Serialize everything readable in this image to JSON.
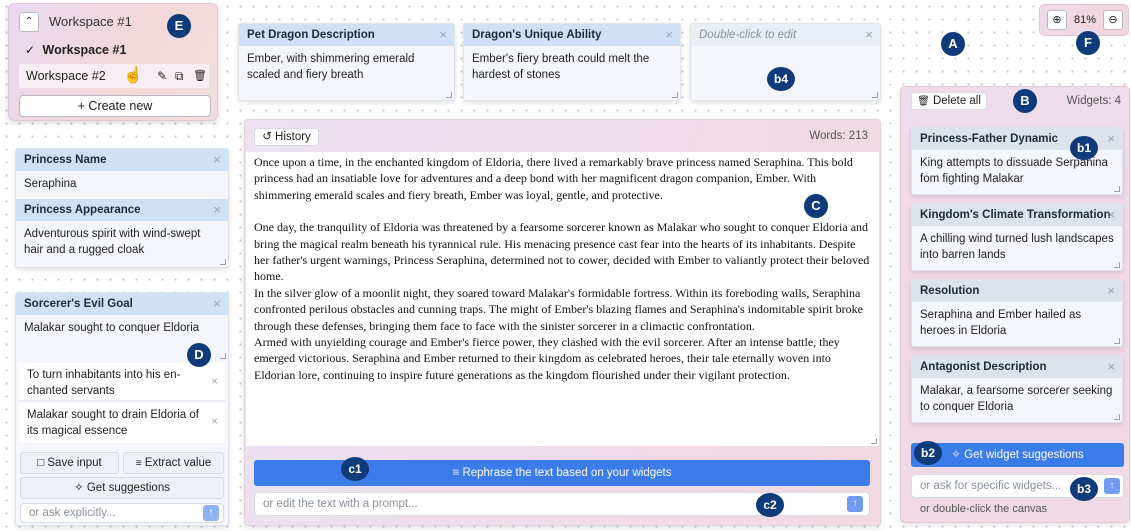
{
  "workspace_menu": {
    "current": "Workspace #1",
    "items": [
      {
        "label": "Workspace #1",
        "checked": true
      },
      {
        "label": "Workspace #2",
        "checked": false
      }
    ],
    "create_label": "+ Create new"
  },
  "canvas_zoom": {
    "value": "81%"
  },
  "top_widgets": [
    {
      "title": "Pet Dragon Description",
      "body": "Ember, with shimmering emerald scaled and fiery breath"
    },
    {
      "title": "Dragon's Unique Ability",
      "body": "Ember's fiery breath could melt the hardest of stones"
    },
    {
      "title": "Double-click to edit",
      "body": ""
    }
  ],
  "left_widgets": [
    {
      "title": "Princess Name",
      "body": "Seraphina"
    },
    {
      "title": "Princess Appearance",
      "body": "Adventurous spirit with wind-swept hair and a rugged cloak"
    }
  ],
  "goal_widget": {
    "title": "Sorcerer's Evil Goal",
    "body": "Malakar sought to conquer Eldoria",
    "suggestions": [
      "To turn inhabitants into his en-chanted servants",
      "Malakar sought to drain Eldoria of its magical essence"
    ],
    "save_label": "Save input",
    "extract_label": "Extract value",
    "suggest_label": "Get suggestions",
    "ask_placeholder": "or ask explicitly..."
  },
  "editor": {
    "history_label": "History",
    "word_count": "Words: 213",
    "paragraphs": [
      "Once upon a time, in the enchanted kingdom of Eldoria, there lived a remarkably brave princess named Seraphina. This bold princess had an insatiable love for adventures and a deep bond with her magnificent dragon companion, Ember. With shimmering emerald scales and fiery breath, Ember was loyal, gentle, and protective.",
      "",
      "One day, the tranquility of Eldoria was threatened by a fearsome sorcerer known as Malakar who sought to conquer Eldoria and bring the magical realm beneath his tyrannical rule. His menacing presence cast fear into the hearts of its inhabitants. Despite her father's urgent warnings, Princess Seraphina, determined not to cower, decided with Ember to valiantly protect their beloved home.",
      "In the silver glow of a moonlit night, they soared toward Malakar's formidable fortress. Within its foreboding walls, Seraphina confronted perilous obstacles and cunning traps. The might of Ember's blazing flames and Seraphina's indomitable spirit broke through these defenses, bringing them face to face with the sinister sorcerer in a climactic confrontation.",
      "Armed with unyielding courage and Ember's fierce power, they clashed with the evil sorcerer. After an intense battle, they emerged victorious. Seraphina and Ember returned to their kingdom as celebrated heroes, their tale eternally woven into Eldorian lore, continuing to inspire future generations as the kingdom flourished under their vigilant protection."
    ],
    "rephrase_label": "Rephrase the text based on your widgets",
    "prompt_placeholder": "or edit the text with a prompt..."
  },
  "right_panel": {
    "delete_label": "Delete all",
    "widget_count": "Widgets: 4",
    "widgets": [
      {
        "title": "Princess-Father Dynamic",
        "body": "King attempts to dissuade Serpahina fom fighting Malakar"
      },
      {
        "title": "Kingdom's Climate Transformation",
        "body": "A chilling wind turned lush landscapes into barren lands"
      },
      {
        "title": "Resolution",
        "body": "Seraphina and Ember hailed as heroes in Eldoria"
      },
      {
        "title": "Antagonist Description",
        "body": "Malakar, a fearsome sorcerer seeking to conquer Eldoria"
      }
    ],
    "suggest_label": "Get widget suggestions",
    "ask_placeholder": "or ask for specific widgets...",
    "hint": "or double-click the canvas"
  },
  "labels": {
    "A": "A",
    "B": "B",
    "C": "C",
    "D": "D",
    "E": "E",
    "F": "F",
    "b1": "b1",
    "b2": "b2",
    "b3": "b3",
    "b4": "b4",
    "c1": "c1",
    "c2": "c2"
  },
  "icons": [
    "chevron-up-icon",
    "check-icon",
    "pencil-icon",
    "copy-icon",
    "trash-icon",
    "hand-cursor-icon",
    "zoom-in-icon",
    "zoom-out-icon",
    "history-icon",
    "bookmark-icon",
    "extract-icon",
    "sparkle-icon",
    "rephrase-icon",
    "send-arrow-icon",
    "close-icon"
  ]
}
